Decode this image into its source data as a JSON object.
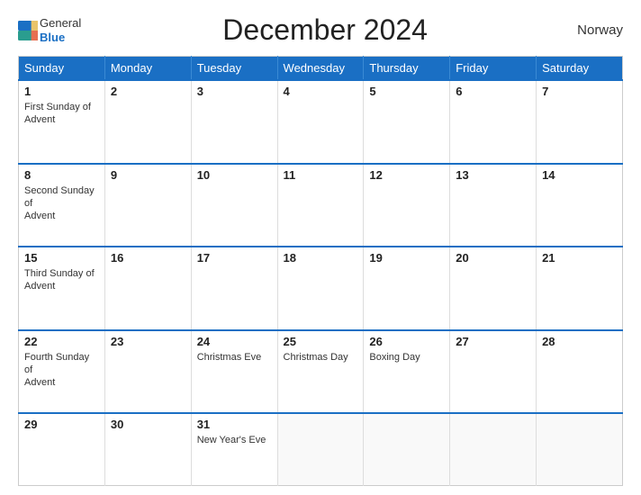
{
  "header": {
    "title": "December 2024",
    "country": "Norway",
    "logo_line1": "General",
    "logo_line2": "Blue"
  },
  "days_of_week": [
    "Sunday",
    "Monday",
    "Tuesday",
    "Wednesday",
    "Thursday",
    "Friday",
    "Saturday"
  ],
  "weeks": [
    [
      {
        "day": "1",
        "events": [
          "First Sunday of",
          "Advent"
        ]
      },
      {
        "day": "2",
        "events": []
      },
      {
        "day": "3",
        "events": []
      },
      {
        "day": "4",
        "events": []
      },
      {
        "day": "5",
        "events": []
      },
      {
        "day": "6",
        "events": []
      },
      {
        "day": "7",
        "events": []
      }
    ],
    [
      {
        "day": "8",
        "events": [
          "Second Sunday of",
          "Advent"
        ]
      },
      {
        "day": "9",
        "events": []
      },
      {
        "day": "10",
        "events": []
      },
      {
        "day": "11",
        "events": []
      },
      {
        "day": "12",
        "events": []
      },
      {
        "day": "13",
        "events": []
      },
      {
        "day": "14",
        "events": []
      }
    ],
    [
      {
        "day": "15",
        "events": [
          "Third Sunday of",
          "Advent"
        ]
      },
      {
        "day": "16",
        "events": []
      },
      {
        "day": "17",
        "events": []
      },
      {
        "day": "18",
        "events": []
      },
      {
        "day": "19",
        "events": []
      },
      {
        "day": "20",
        "events": []
      },
      {
        "day": "21",
        "events": []
      }
    ],
    [
      {
        "day": "22",
        "events": [
          "Fourth Sunday of",
          "Advent"
        ]
      },
      {
        "day": "23",
        "events": []
      },
      {
        "day": "24",
        "events": [
          "Christmas Eve"
        ]
      },
      {
        "day": "25",
        "events": [
          "Christmas Day"
        ]
      },
      {
        "day": "26",
        "events": [
          "Boxing Day"
        ]
      },
      {
        "day": "27",
        "events": []
      },
      {
        "day": "28",
        "events": []
      }
    ],
    [
      {
        "day": "29",
        "events": []
      },
      {
        "day": "30",
        "events": []
      },
      {
        "day": "31",
        "events": [
          "New Year's Eve"
        ]
      },
      {
        "day": "",
        "events": []
      },
      {
        "day": "",
        "events": []
      },
      {
        "day": "",
        "events": []
      },
      {
        "day": "",
        "events": []
      }
    ]
  ]
}
